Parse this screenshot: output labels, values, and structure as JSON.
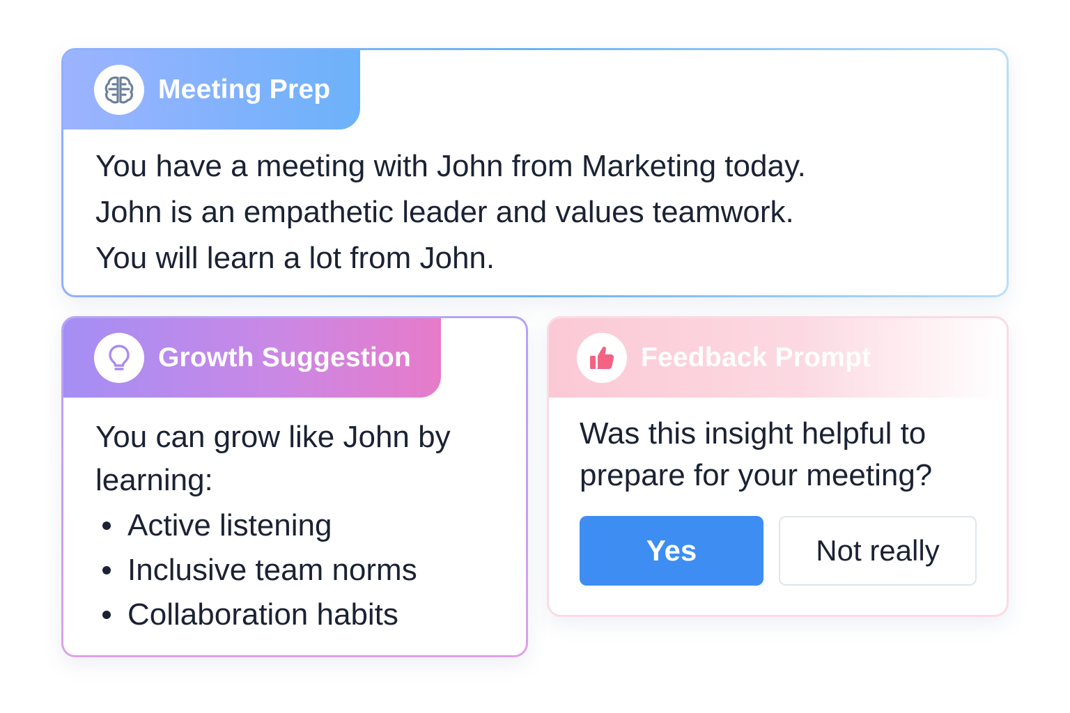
{
  "meeting_prep": {
    "title": "Meeting Prep",
    "icon": "brain-icon",
    "lines": [
      "You have a meeting with John from Marketing today.",
      "John is an empathetic leader and values teamwork.",
      "You will learn a lot from John."
    ]
  },
  "growth_suggestion": {
    "title": "Growth Suggestion",
    "icon": "lightbulb-icon",
    "intro": "You can grow like John by learning:",
    "items": [
      "Active listening",
      "Inclusive team norms",
      "Collaboration habits"
    ]
  },
  "feedback_prompt": {
    "title": "Feedback Prompt",
    "icon": "thumbs-up-icon",
    "question": "Was this insight helpful to prepare for your meeting?",
    "yes_label": "Yes",
    "no_label": "Not really"
  },
  "colors": {
    "meeting_accent": "#6cb2fa",
    "growth_accent": "#c988e6",
    "feedback_accent": "#fbc9d5",
    "primary_button": "#3d8df2",
    "text": "#1a2233"
  }
}
